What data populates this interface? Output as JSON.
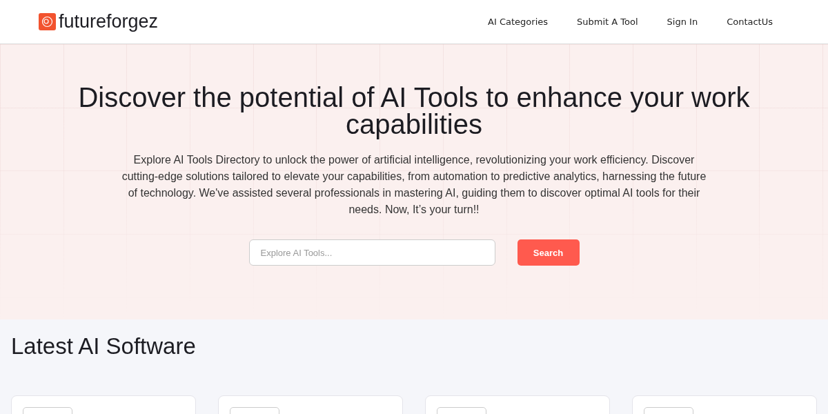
{
  "header": {
    "logo": "futureforgez",
    "nav": [
      {
        "label": "AI Categories"
      },
      {
        "label": "Submit A Tool"
      },
      {
        "label": "Sign In"
      },
      {
        "label": "ContactUs"
      }
    ]
  },
  "hero": {
    "title": "Discover the potential of AI Tools to enhance your work capabilities",
    "description": "Explore AI Tools Directory to unlock the power of artificial intelligence, revolutionizing your work efficiency. Discover cutting-edge solutions tailored to elevate your capabilities, from automation to predictive analytics, harnessing the future of technology. We've assisted several professionals in mastering AI, guiding them to discover optimal AI tools for their needs. Now, It’s your turn!!",
    "search": {
      "placeholder": "Explore AI Tools..."
    },
    "button": "Search"
  },
  "latest": {
    "title": "Latest AI Software"
  }
}
